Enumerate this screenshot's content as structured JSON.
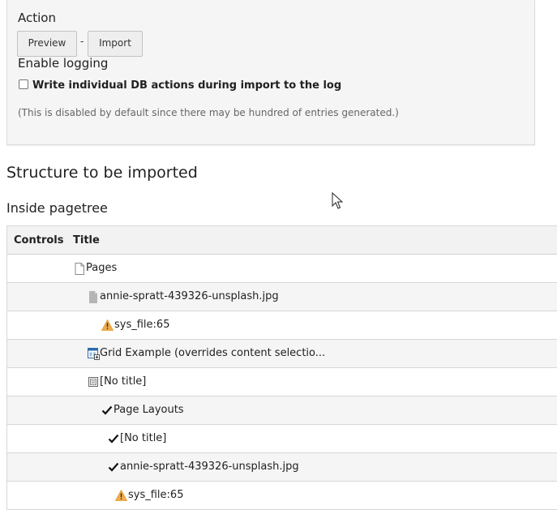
{
  "settings": {
    "action_label": "Action",
    "preview_button": "Preview",
    "separator": "-",
    "import_button": "Import",
    "logging_label": "Enable logging",
    "log_checkbox_label": "Write individual DB actions during import to the log",
    "log_checkbox_checked": false,
    "log_hint": "(This is disabled by default since there may be hundred of entries generated.)"
  },
  "structure": {
    "heading": "Structure to be imported",
    "subheading": "Inside pagetree",
    "columns": [
      "Controls",
      "Title"
    ],
    "rows": [
      {
        "icon": "page-icon",
        "title": "Pages"
      },
      {
        "icon": "file-icon",
        "title": "annie-spratt-439326-unsplash.jpg"
      },
      {
        "icon": "warning-icon",
        "title": "sys_file:65"
      },
      {
        "icon": "grid-content-icon",
        "title": "Grid Example (overrides content selectio..."
      },
      {
        "icon": "content-element-icon",
        "title": "[No title]"
      },
      {
        "icon": "checkmark-icon",
        "title": "Page Layouts"
      },
      {
        "icon": "checkmark-icon",
        "title": "[No title]"
      },
      {
        "icon": "checkmark-icon",
        "title": "annie-spratt-439326-unsplash.jpg"
      },
      {
        "icon": "warning-icon",
        "title": "sys_file:65"
      }
    ]
  },
  "colors": {
    "warning": "#f0ad4e",
    "grid_icon_blue": "#2b6cb0",
    "panel_bg": "#f5f5f5"
  }
}
